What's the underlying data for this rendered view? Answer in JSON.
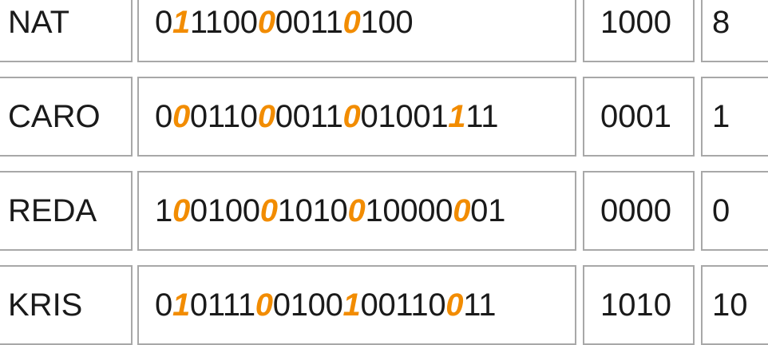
{
  "rows": [
    {
      "name": "NAT",
      "bits": [
        {
          "t": "0",
          "hl": false
        },
        {
          "t": "1",
          "hl": true
        },
        {
          "t": "1",
          "hl": false
        },
        {
          "t": "1",
          "hl": false
        },
        {
          "t": "0",
          "hl": false
        },
        {
          "t": "0",
          "hl": false
        },
        {
          "t": "0",
          "hl": true
        },
        {
          "t": "0",
          "hl": false
        },
        {
          "t": "0",
          "hl": false
        },
        {
          "t": "1",
          "hl": false
        },
        {
          "t": "1",
          "hl": false
        },
        {
          "t": "0",
          "hl": true
        },
        {
          "t": "1",
          "hl": false
        },
        {
          "t": "0",
          "hl": false
        },
        {
          "t": "0",
          "hl": false
        }
      ],
      "code": "1000",
      "decimal": "8"
    },
    {
      "name": "CARO",
      "bits": [
        {
          "t": "0",
          "hl": false
        },
        {
          "t": "0",
          "hl": true
        },
        {
          "t": "0",
          "hl": false
        },
        {
          "t": "1",
          "hl": false
        },
        {
          "t": "1",
          "hl": false
        },
        {
          "t": "0",
          "hl": false
        },
        {
          "t": "0",
          "hl": true
        },
        {
          "t": "0",
          "hl": false
        },
        {
          "t": "0",
          "hl": false
        },
        {
          "t": "1",
          "hl": false
        },
        {
          "t": "1",
          "hl": false
        },
        {
          "t": "0",
          "hl": true
        },
        {
          "t": "0",
          "hl": false
        },
        {
          "t": "1",
          "hl": false
        },
        {
          "t": "0",
          "hl": false
        },
        {
          "t": "0",
          "hl": false
        },
        {
          "t": "1",
          "hl": false
        },
        {
          "t": "1",
          "hl": true
        },
        {
          "t": "1",
          "hl": false
        },
        {
          "t": "1",
          "hl": false
        }
      ],
      "code": "0001",
      "decimal": "1"
    },
    {
      "name": "REDA",
      "bits": [
        {
          "t": "1",
          "hl": false
        },
        {
          "t": "0",
          "hl": true
        },
        {
          "t": "0",
          "hl": false
        },
        {
          "t": "1",
          "hl": false
        },
        {
          "t": "0",
          "hl": false
        },
        {
          "t": "0",
          "hl": false
        },
        {
          "t": "0",
          "hl": true
        },
        {
          "t": "1",
          "hl": false
        },
        {
          "t": "0",
          "hl": false
        },
        {
          "t": "1",
          "hl": false
        },
        {
          "t": "0",
          "hl": false
        },
        {
          "t": "0",
          "hl": true
        },
        {
          "t": "1",
          "hl": false
        },
        {
          "t": "0",
          "hl": false
        },
        {
          "t": "0",
          "hl": false
        },
        {
          "t": "0",
          "hl": false
        },
        {
          "t": "0",
          "hl": false
        },
        {
          "t": "0",
          "hl": true
        },
        {
          "t": "0",
          "hl": false
        },
        {
          "t": "1",
          "hl": false
        }
      ],
      "code": "0000",
      "decimal": "0"
    },
    {
      "name": "KRIS",
      "bits": [
        {
          "t": "0",
          "hl": false
        },
        {
          "t": "1",
          "hl": true
        },
        {
          "t": "0",
          "hl": false
        },
        {
          "t": "1",
          "hl": false
        },
        {
          "t": "1",
          "hl": false
        },
        {
          "t": "1",
          "hl": false
        },
        {
          "t": "0",
          "hl": true
        },
        {
          "t": "0",
          "hl": false
        },
        {
          "t": "1",
          "hl": false
        },
        {
          "t": "0",
          "hl": false
        },
        {
          "t": "0",
          "hl": false
        },
        {
          "t": "1",
          "hl": true
        },
        {
          "t": "0",
          "hl": false
        },
        {
          "t": "0",
          "hl": false
        },
        {
          "t": "1",
          "hl": false
        },
        {
          "t": "1",
          "hl": false
        },
        {
          "t": "0",
          "hl": false
        },
        {
          "t": "0",
          "hl": true
        },
        {
          "t": "1",
          "hl": false
        },
        {
          "t": "1",
          "hl": false
        }
      ],
      "code": "1010",
      "decimal": "10"
    }
  ],
  "colors": {
    "highlight": "#f28c00",
    "border": "#a8a8a8",
    "text": "#1a1a1a"
  }
}
